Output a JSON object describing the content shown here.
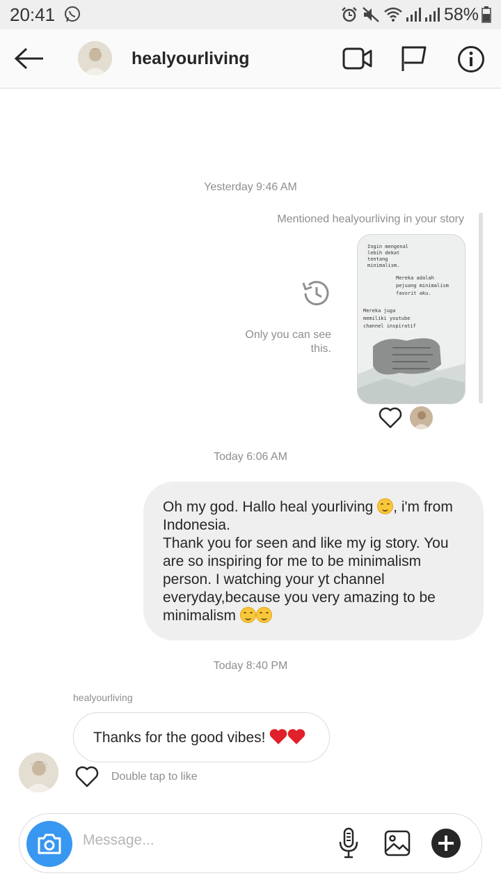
{
  "status_bar": {
    "time": "20:41",
    "battery": "58%"
  },
  "header": {
    "username": "healyourliving",
    "icons": [
      "back-arrow-icon",
      "video-call-icon",
      "flag-icon",
      "info-icon"
    ]
  },
  "thread": {
    "timestamp_1": "Yesterday 9:46 AM",
    "story_mention": {
      "label": "Mentioned healyourliving in your story",
      "only_you_line1": "Only you can see",
      "only_you_line2": "this.",
      "story_text": [
        "Ingin mengenal",
        "lebih dekat",
        "tentang",
        "minimalism.",
        "Mereka adalah",
        "pejuang minimalism",
        "favorit aku.",
        "Mereka juga",
        "memiliki youtube",
        "channel inspiratif"
      ]
    },
    "timestamp_2": "Today 6:06 AM",
    "outgoing_message": {
      "line1_before_emoji": "Oh my god. Hallo heal yourliving ",
      "line1_after_emoji": ", i'm from",
      "line2": "Indonesia.",
      "line3": "Thank you for seen and like my ig story. You",
      "line4": "are so inspiring for me to be minimalism",
      "line5": "person. I watching your yt channel",
      "line6": "everyday,because you very amazing to be",
      "line7": "minimalism "
    },
    "timestamp_3": "Today 8:40 PM",
    "incoming_sender": "healyourliving",
    "incoming_message": "Thanks for the good vibes! ",
    "double_tap_hint": "Double tap to like"
  },
  "composer": {
    "placeholder": "Message..."
  },
  "colors": {
    "accent_blue": "#3897f0",
    "heart_red": "#e0202b",
    "outgoing_bubble": "#efefef"
  }
}
